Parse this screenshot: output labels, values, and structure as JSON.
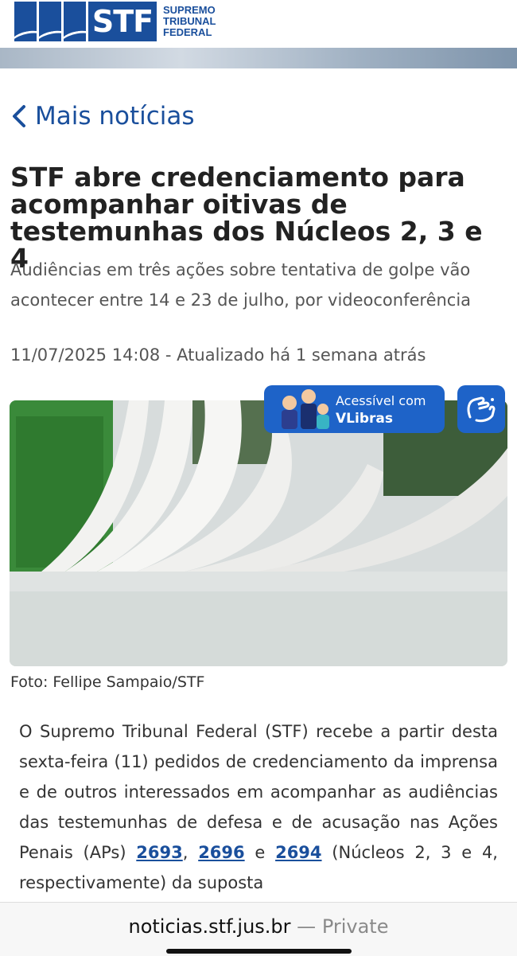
{
  "header": {
    "logo_abbrev": "STF",
    "logo_line1": "SUPREMO",
    "logo_line2": "TRIBUNAL",
    "logo_line3": "FEDERAL",
    "brand_color": "#1a4f9c"
  },
  "nav": {
    "back_label": "Mais notícias",
    "back_icon": "chevron-left-icon"
  },
  "article": {
    "title": "STF abre credenciamento para acompanhar oitivas de testemunhas dos Núcleos 2, 3 e 4",
    "subtitle": "Audiências em três ações sobre tentativa de golpe vão acontecer entre 14 e 23 de julho, por videoconferência",
    "date": "11/07/2025 14:08 - Atualizado há 1 semana atrás",
    "photo_caption": "Foto: Fellipe Sampaio/STF",
    "body_part1": "O Supremo Tribunal Federal (STF) recebe a partir desta sexta-feira (11) pedidos de credenciamento da imprensa e de outros interessados em acompanhar as audiências das testemunhas de defesa e de acusação nas Ações Penais (APs) ",
    "link1": "2693",
    "sep1": ", ",
    "link2": "2696",
    "sep2": " e ",
    "link3": "2694",
    "body_part2": " (Núcleos 2, 3 e 4, respectivamente) da suposta"
  },
  "vlibras": {
    "line1": "Acessível com",
    "line2": "VLibras",
    "color": "#1e63c8"
  },
  "browser": {
    "host": "noticias.stf.jus.br",
    "separator": " — ",
    "mode": "Private"
  }
}
